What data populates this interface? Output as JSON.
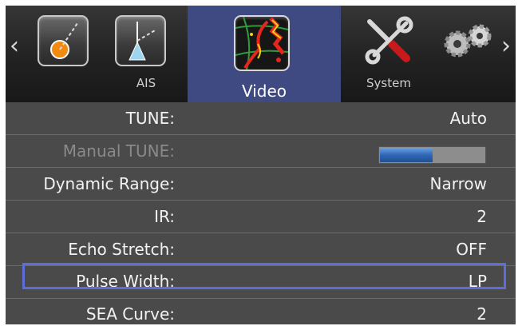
{
  "tabs": {
    "prev_arrow": "‹",
    "next_arrow": "›",
    "items": [
      {
        "label": "",
        "icon": "range-ring-dial-icon"
      },
      {
        "label": "AIS",
        "icon": "ais-vector-icon"
      },
      {
        "label": "Video",
        "icon": "radar-video-icon",
        "selected": true
      },
      {
        "label": "System",
        "icon": "tools-icon"
      },
      {
        "label": "",
        "icon": "gears-icon"
      }
    ]
  },
  "settings": [
    {
      "label": "TUNE:",
      "value": "Auto"
    },
    {
      "label": "Manual TUNE:",
      "value": "",
      "disabled": true,
      "bar_fraction": 0.5
    },
    {
      "label": "Dynamic Range:",
      "value": "Narrow"
    },
    {
      "label": "IR:",
      "value": "2"
    },
    {
      "label": "Echo Stretch:",
      "value": "OFF"
    },
    {
      "label": "Pulse Width:",
      "value": "LP",
      "selected": true
    },
    {
      "label": "SEA Curve:",
      "value": "2"
    }
  ],
  "colors": {
    "selected_tab": "#3f4a82",
    "highlight_border": "#5e6ed8",
    "panel_bg": "#4a4a4a",
    "bar_fill": "#2f66b8"
  }
}
